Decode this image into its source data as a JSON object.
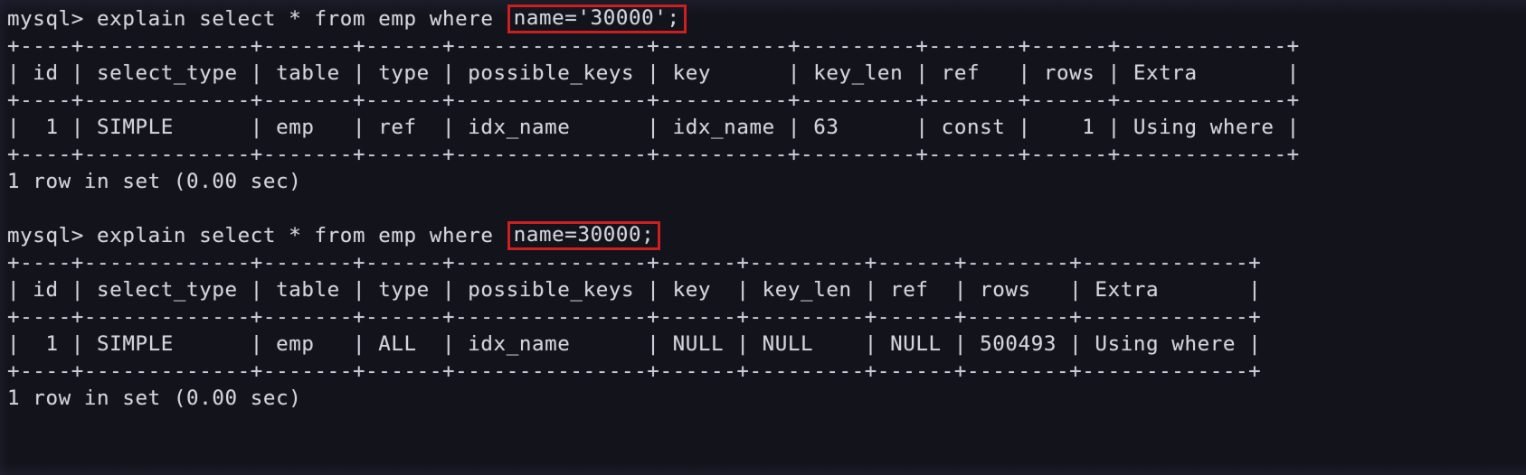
{
  "terminal": {
    "app": "mysql-client",
    "background_color": "#12131b",
    "foreground_color": "#d2d4dc",
    "highlight_border_color": "#cc1f1f"
  },
  "blocks": [
    {
      "id": "query-1",
      "prompt": "mysql> ",
      "statement_before": "explain select * from emp where ",
      "statement_highlight": "name='30000';",
      "table": {
        "rule": "+----+-------------+-------+------+---------------+----------+---------+-------+------+-------------+",
        "header": "| id | select_type | table | type | possible_keys | key      | key_len | ref   | rows | Extra       |",
        "row": "|  1 | SIMPLE      | emp   | ref  | idx_name      | idx_name | 63      | const |    1 | Using where |",
        "columns": [
          "id",
          "select_type",
          "table",
          "type",
          "possible_keys",
          "key",
          "key_len",
          "ref",
          "rows",
          "Extra"
        ],
        "values": [
          "1",
          "SIMPLE",
          "emp",
          "ref",
          "idx_name",
          "idx_name",
          "63",
          "const",
          "1",
          "Using where"
        ]
      },
      "result": "1 row in set (0.00 sec)"
    },
    {
      "id": "query-2",
      "prompt": "mysql> ",
      "statement_before": "explain select * from emp where ",
      "statement_highlight": "name=30000;",
      "table": {
        "rule": "+----+-------------+-------+------+---------------+------+---------+------+--------+-------------+",
        "header": "| id | select_type | table | type | possible_keys | key  | key_len | ref  | rows   | Extra       |",
        "row": "|  1 | SIMPLE      | emp   | ALL  | idx_name      | NULL | NULL    | NULL | 500493 | Using where |",
        "columns": [
          "id",
          "select_type",
          "table",
          "type",
          "possible_keys",
          "key",
          "key_len",
          "ref",
          "rows",
          "Extra"
        ],
        "values": [
          "1",
          "SIMPLE",
          "emp",
          "ALL",
          "idx_name",
          "NULL",
          "NULL",
          "NULL",
          "500493",
          "Using where"
        ]
      },
      "result": "1 row in set (0.00 sec)"
    }
  ]
}
